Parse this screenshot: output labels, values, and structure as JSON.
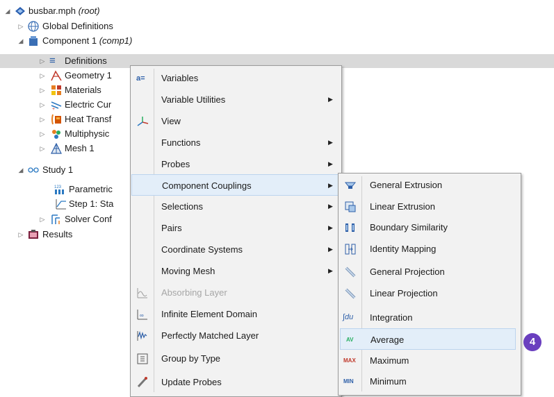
{
  "tree": {
    "root": {
      "label": "busbar.mph",
      "note": "(root)"
    },
    "items": [
      {
        "label": "Global Definitions"
      },
      {
        "label": "Component 1",
        "note": "(comp1)"
      },
      {
        "label": "Definitions"
      },
      {
        "label": "Geometry 1"
      },
      {
        "label": "Materials"
      },
      {
        "label": "Electric Cur"
      },
      {
        "label": "Heat Transf"
      },
      {
        "label": "Multiphysic"
      },
      {
        "label": "Mesh 1"
      },
      {
        "label": "Study 1"
      },
      {
        "label": "Parametric"
      },
      {
        "label": "Step 1: Sta"
      },
      {
        "label": "Solver Conf"
      },
      {
        "label": "Results"
      }
    ]
  },
  "context_menu": {
    "items": [
      {
        "label": "Variables",
        "icon": "variables-icon"
      },
      {
        "label": "Variable Utilities",
        "submenu": true
      },
      {
        "label": "View",
        "icon": "view-axes-icon"
      },
      {
        "label": "Functions",
        "submenu": true
      },
      {
        "label": "Probes",
        "submenu": true
      },
      {
        "label": "Component Couplings",
        "submenu": true,
        "highlighted": true
      },
      {
        "label": "Selections",
        "submenu": true
      },
      {
        "label": "Pairs",
        "submenu": true
      },
      {
        "label": "Coordinate Systems",
        "submenu": true
      },
      {
        "label": "Moving Mesh",
        "submenu": true
      },
      {
        "label": "Absorbing Layer",
        "disabled": true
      },
      {
        "label": "Infinite Element Domain"
      },
      {
        "label": "Perfectly Matched Layer"
      },
      {
        "label": "Group by Type"
      },
      {
        "label": "Update Probes"
      }
    ]
  },
  "submenu": {
    "items": [
      {
        "label": "General Extrusion"
      },
      {
        "label": "Linear Extrusion"
      },
      {
        "label": "Boundary Similarity"
      },
      {
        "label": "Identity Mapping"
      },
      {
        "label": "General Projection"
      },
      {
        "label": "Linear Projection"
      },
      {
        "label": "Integration",
        "icon_text": "∫du"
      },
      {
        "label": "Average",
        "icon_text": "AV",
        "highlighted": true
      },
      {
        "label": "Maximum",
        "icon_text": "MAX"
      },
      {
        "label": "Minimum",
        "icon_text": "MIN"
      }
    ]
  },
  "menu_icons": {
    "variables_text": "a="
  },
  "badge": {
    "text": "4"
  },
  "colors": {
    "selection": "#d9d9d9",
    "highlight": "#e3eef9",
    "badge": "#6a3fbf"
  }
}
